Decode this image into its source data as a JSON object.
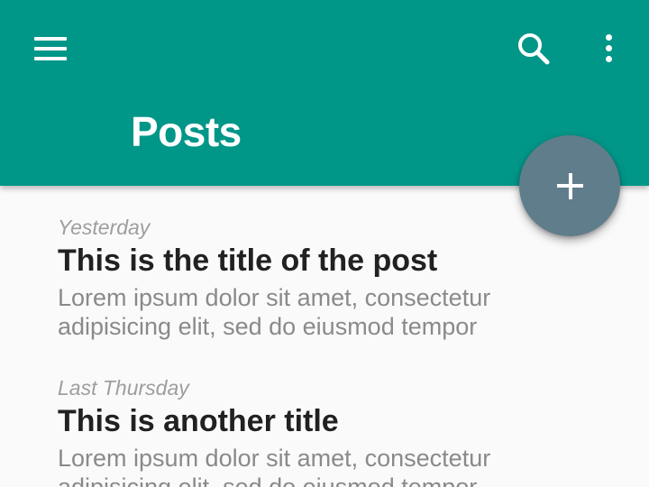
{
  "appbar": {
    "title": "Posts",
    "color": "#009688",
    "menu_icon": "hamburger-menu-icon",
    "search_icon": "search-icon",
    "more_icon": "more-vert-icon"
  },
  "fab": {
    "icon": "plus-icon",
    "color": "#607d8b"
  },
  "posts": [
    {
      "date": "Yesterday",
      "title": "This is the title of the post",
      "excerpt": "Lorem ipsum dolor sit amet, consectetur adipisicing elit, sed do eiusmod tempor"
    },
    {
      "date": "Last Thursday",
      "title": "This is another title",
      "excerpt": "Lorem ipsum dolor sit amet, consectetur adipisicing elit, sed do eiusmod tempor"
    }
  ]
}
